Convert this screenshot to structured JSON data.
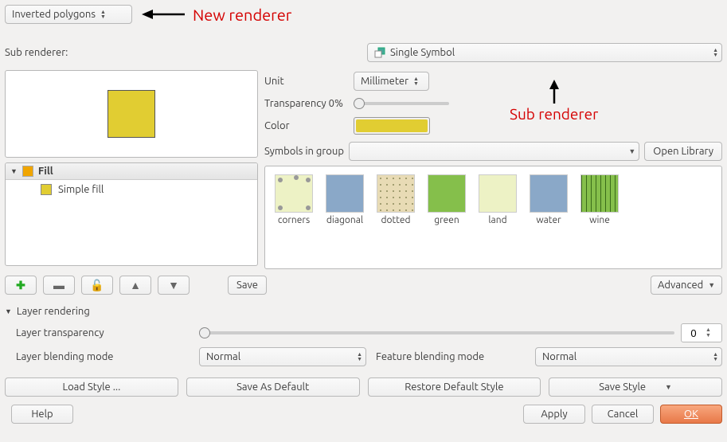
{
  "renderer": {
    "selected": "Inverted polygons",
    "annotation": "New renderer"
  },
  "subrenderer": {
    "label": "Sub renderer:",
    "selected": "Single Symbol",
    "annotation": "Sub renderer"
  },
  "properties": {
    "unit_label": "Unit",
    "unit_value": "Millimeter",
    "transparency_label": "Transparency 0%",
    "color_label": "Color",
    "color_hex": "#e1cd32"
  },
  "symbol_tree": {
    "fill_label": "Fill",
    "simple_fill_label": "Simple fill"
  },
  "symbols_group": {
    "label": "Symbols in group",
    "open_library": "Open Library",
    "items": [
      "corners",
      "diagonal",
      "dotted",
      "green",
      "land",
      "water",
      "wine"
    ]
  },
  "tree_toolbar": {
    "save": "Save",
    "advanced": "Advanced"
  },
  "layer_rendering": {
    "header": "Layer rendering",
    "transparency_label": "Layer transparency",
    "transparency_value": "0",
    "layer_blend_label": "Layer blending mode",
    "layer_blend_value": "Normal",
    "feature_blend_label": "Feature blending mode",
    "feature_blend_value": "Normal"
  },
  "style_buttons": {
    "load": "Load Style ...",
    "save_default": "Save As Default",
    "restore": "Restore Default Style",
    "save": "Save Style"
  },
  "bottom": {
    "help": "Help",
    "apply": "Apply",
    "cancel": "Cancel",
    "ok": "OK"
  }
}
